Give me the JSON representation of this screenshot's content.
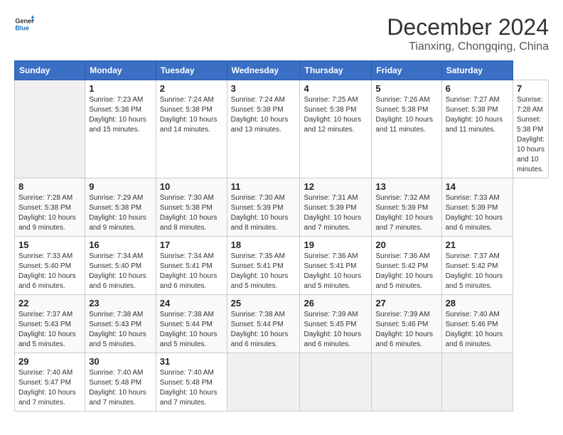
{
  "header": {
    "logo_line1": "General",
    "logo_line2": "Blue",
    "main_title": "December 2024",
    "subtitle": "Tianxing, Chongqing, China"
  },
  "calendar": {
    "days_of_week": [
      "Sunday",
      "Monday",
      "Tuesday",
      "Wednesday",
      "Thursday",
      "Friday",
      "Saturday"
    ],
    "weeks": [
      [
        {
          "day": "",
          "info": ""
        },
        {
          "day": "1",
          "info": "Sunrise: 7:23 AM\nSunset: 5:38 PM\nDaylight: 10 hours and 15 minutes."
        },
        {
          "day": "2",
          "info": "Sunrise: 7:24 AM\nSunset: 5:38 PM\nDaylight: 10 hours and 14 minutes."
        },
        {
          "day": "3",
          "info": "Sunrise: 7:24 AM\nSunset: 5:38 PM\nDaylight: 10 hours and 13 minutes."
        },
        {
          "day": "4",
          "info": "Sunrise: 7:25 AM\nSunset: 5:38 PM\nDaylight: 10 hours and 12 minutes."
        },
        {
          "day": "5",
          "info": "Sunrise: 7:26 AM\nSunset: 5:38 PM\nDaylight: 10 hours and 11 minutes."
        },
        {
          "day": "6",
          "info": "Sunrise: 7:27 AM\nSunset: 5:38 PM\nDaylight: 10 hours and 11 minutes."
        },
        {
          "day": "7",
          "info": "Sunrise: 7:28 AM\nSunset: 5:38 PM\nDaylight: 10 hours and 10 minutes."
        }
      ],
      [
        {
          "day": "8",
          "info": "Sunrise: 7:28 AM\nSunset: 5:38 PM\nDaylight: 10 hours and 9 minutes."
        },
        {
          "day": "9",
          "info": "Sunrise: 7:29 AM\nSunset: 5:38 PM\nDaylight: 10 hours and 9 minutes."
        },
        {
          "day": "10",
          "info": "Sunrise: 7:30 AM\nSunset: 5:38 PM\nDaylight: 10 hours and 8 minutes."
        },
        {
          "day": "11",
          "info": "Sunrise: 7:30 AM\nSunset: 5:39 PM\nDaylight: 10 hours and 8 minutes."
        },
        {
          "day": "12",
          "info": "Sunrise: 7:31 AM\nSunset: 5:39 PM\nDaylight: 10 hours and 7 minutes."
        },
        {
          "day": "13",
          "info": "Sunrise: 7:32 AM\nSunset: 5:39 PM\nDaylight: 10 hours and 7 minutes."
        },
        {
          "day": "14",
          "info": "Sunrise: 7:33 AM\nSunset: 5:39 PM\nDaylight: 10 hours and 6 minutes."
        }
      ],
      [
        {
          "day": "15",
          "info": "Sunrise: 7:33 AM\nSunset: 5:40 PM\nDaylight: 10 hours and 6 minutes."
        },
        {
          "day": "16",
          "info": "Sunrise: 7:34 AM\nSunset: 5:40 PM\nDaylight: 10 hours and 6 minutes."
        },
        {
          "day": "17",
          "info": "Sunrise: 7:34 AM\nSunset: 5:41 PM\nDaylight: 10 hours and 6 minutes."
        },
        {
          "day": "18",
          "info": "Sunrise: 7:35 AM\nSunset: 5:41 PM\nDaylight: 10 hours and 5 minutes."
        },
        {
          "day": "19",
          "info": "Sunrise: 7:36 AM\nSunset: 5:41 PM\nDaylight: 10 hours and 5 minutes."
        },
        {
          "day": "20",
          "info": "Sunrise: 7:36 AM\nSunset: 5:42 PM\nDaylight: 10 hours and 5 minutes."
        },
        {
          "day": "21",
          "info": "Sunrise: 7:37 AM\nSunset: 5:42 PM\nDaylight: 10 hours and 5 minutes."
        }
      ],
      [
        {
          "day": "22",
          "info": "Sunrise: 7:37 AM\nSunset: 5:43 PM\nDaylight: 10 hours and 5 minutes."
        },
        {
          "day": "23",
          "info": "Sunrise: 7:38 AM\nSunset: 5:43 PM\nDaylight: 10 hours and 5 minutes."
        },
        {
          "day": "24",
          "info": "Sunrise: 7:38 AM\nSunset: 5:44 PM\nDaylight: 10 hours and 5 minutes."
        },
        {
          "day": "25",
          "info": "Sunrise: 7:38 AM\nSunset: 5:44 PM\nDaylight: 10 hours and 6 minutes."
        },
        {
          "day": "26",
          "info": "Sunrise: 7:39 AM\nSunset: 5:45 PM\nDaylight: 10 hours and 6 minutes."
        },
        {
          "day": "27",
          "info": "Sunrise: 7:39 AM\nSunset: 5:46 PM\nDaylight: 10 hours and 6 minutes."
        },
        {
          "day": "28",
          "info": "Sunrise: 7:40 AM\nSunset: 5:46 PM\nDaylight: 10 hours and 6 minutes."
        }
      ],
      [
        {
          "day": "29",
          "info": "Sunrise: 7:40 AM\nSunset: 5:47 PM\nDaylight: 10 hours and 7 minutes."
        },
        {
          "day": "30",
          "info": "Sunrise: 7:40 AM\nSunset: 5:48 PM\nDaylight: 10 hours and 7 minutes."
        },
        {
          "day": "31",
          "info": "Sunrise: 7:40 AM\nSunset: 5:48 PM\nDaylight: 10 hours and 7 minutes."
        },
        {
          "day": "",
          "info": ""
        },
        {
          "day": "",
          "info": ""
        },
        {
          "day": "",
          "info": ""
        },
        {
          "day": "",
          "info": ""
        }
      ]
    ]
  }
}
